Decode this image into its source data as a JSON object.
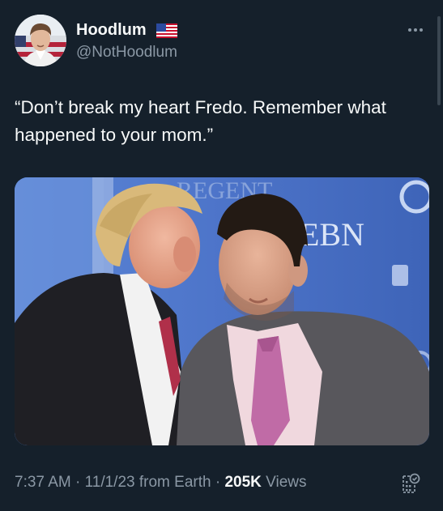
{
  "author": {
    "display_name": "Hoodlum",
    "handle": "@NotHoodlum",
    "badge_icon": "us-flag-icon"
  },
  "tweet": {
    "text": "“Don’t break my heart Fredo. Remember what\nhappened to your mom.”"
  },
  "media": {
    "sign_text_top": "REGENT",
    "sign_text_logo": "EBN"
  },
  "meta": {
    "time": "7:37 AM",
    "sep1": " · ",
    "date": "11/1/23",
    "source": " from Earth",
    "sep2": " · ",
    "views_count": "205K",
    "views_label": " Views"
  },
  "icons": {
    "more": "more-horizontal-icon",
    "analytics": "bookmark-analytics-icon"
  },
  "colors": {
    "background": "#15202b",
    "text_primary": "#f7f9f9",
    "text_secondary": "#8b98a5"
  }
}
